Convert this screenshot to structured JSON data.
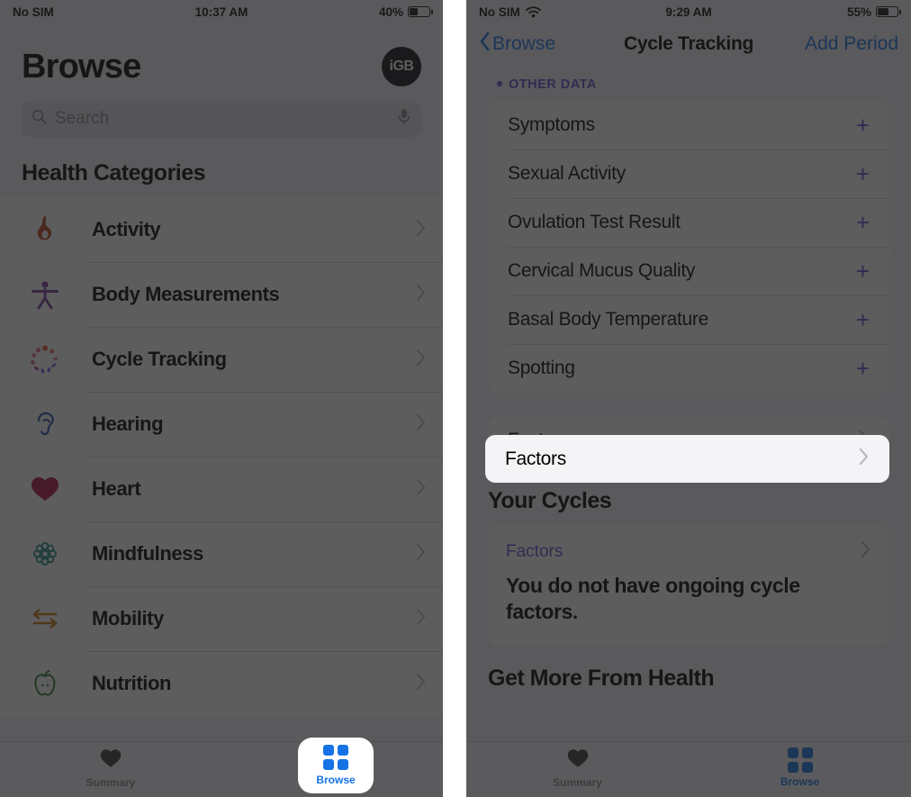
{
  "left": {
    "status_bar": {
      "carrier": "No SIM",
      "time": "10:37 AM",
      "battery_percent": "40%"
    },
    "header": {
      "title": "Browse",
      "logo_text": "iGB"
    },
    "search": {
      "placeholder": "Search",
      "search_icon": "search-icon",
      "mic_icon": "microphone-icon"
    },
    "section_title": "Health Categories",
    "categories": [
      {
        "label": "Activity",
        "icon": "flame-icon",
        "highlighted": false
      },
      {
        "label": "Body Measurements",
        "icon": "body-figure-icon",
        "highlighted": false
      },
      {
        "label": "Cycle Tracking",
        "icon": "cycle-burst-icon",
        "highlighted": true
      },
      {
        "label": "Hearing",
        "icon": "ear-icon",
        "highlighted": false
      },
      {
        "label": "Heart",
        "icon": "heart-icon",
        "highlighted": false
      },
      {
        "label": "Mindfulness",
        "icon": "mandala-icon",
        "highlighted": false
      },
      {
        "label": "Mobility",
        "icon": "arrows-icon",
        "highlighted": false
      },
      {
        "label": "Nutrition",
        "icon": "apple-icon",
        "highlighted": false
      }
    ],
    "tabs": [
      {
        "label": "Summary",
        "icon": "heart-icon",
        "selected": false
      },
      {
        "label": "Browse",
        "icon": "grid-icon",
        "selected": true
      }
    ]
  },
  "right": {
    "status_bar": {
      "carrier": "No SIM",
      "wifi_icon": "wifi-icon",
      "time": "9:29 AM",
      "battery_percent": "55%"
    },
    "navbar": {
      "back_label": "Browse",
      "back_icon": "chevron-left-icon",
      "title": "Cycle Tracking",
      "action_label": "Add Period"
    },
    "other_data": {
      "section_label": "OTHER DATA",
      "rows": [
        {
          "label": "Symptoms",
          "action_icon": "plus-icon"
        },
        {
          "label": "Sexual Activity",
          "action_icon": "plus-icon"
        },
        {
          "label": "Ovulation Test Result",
          "action_icon": "plus-icon"
        },
        {
          "label": "Cervical Mucus Quality",
          "action_icon": "plus-icon"
        },
        {
          "label": "Basal Body Temperature",
          "action_icon": "plus-icon"
        },
        {
          "label": "Spotting",
          "action_icon": "plus-icon"
        }
      ]
    },
    "factors_row": {
      "label": "Factors",
      "chevron_icon": "chevron-right-icon",
      "highlighted": true
    },
    "your_cycles": {
      "heading": "Your Cycles",
      "card_link_label": "Factors",
      "card_body": "You do not have ongoing cycle factors."
    },
    "get_more_heading": "Get More From Health",
    "tabs": [
      {
        "label": "Summary",
        "icon": "heart-icon",
        "selected": false
      },
      {
        "label": "Browse",
        "icon": "grid-icon",
        "selected": true
      }
    ]
  },
  "colors": {
    "accent_blue": "#1573e6",
    "accent_purple": "#5f4fcf",
    "activity_orange": "#c0431a",
    "body_purple": "#7b3fa0",
    "hearing_blue": "#2a4f9e",
    "heart_red": "#b01040",
    "mindfulness_teal": "#1f8a80",
    "mobility_orange": "#cc7a0a",
    "nutrition_green": "#2e7d32"
  }
}
